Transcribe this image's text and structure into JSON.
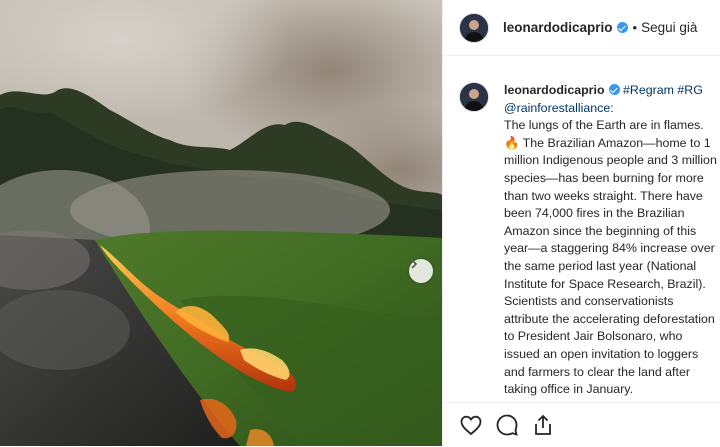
{
  "post": {
    "username": "leonardodicaprio",
    "separator": "•",
    "follow_label": "Segui già",
    "regram_tags": [
      "#Regram",
      "#RG"
    ],
    "mention": "@rainforestalliance",
    "mention_suffix": ":",
    "caption_first_line": "The lungs of the Earth are in flames.",
    "caption_emoji": "🔥",
    "caption_rest": " The Brazilian Amazon—home to 1 million Indigenous people and 3 million species—has been burning for more than two weeks straight. There have been 74,000 fires in the Brazilian Amazon since the beginning of this year—a staggering 84% increase over the same period last year (National Institute for Space Research, Brazil). Scientists and conservationists attribute the accelerating deforestation to President Jair Bolsonaro, who issued an open invitation to loggers and farmers to clear the land after taking office in January."
  },
  "icons": {
    "verified": "verified-badge-icon",
    "next": "chevron-right-icon",
    "like": "heart-icon",
    "comment": "comment-bubble-icon",
    "share": "share-icon"
  },
  "colors": {
    "verified": "#3897f0",
    "tag": "#003569",
    "border": "#efefef"
  }
}
